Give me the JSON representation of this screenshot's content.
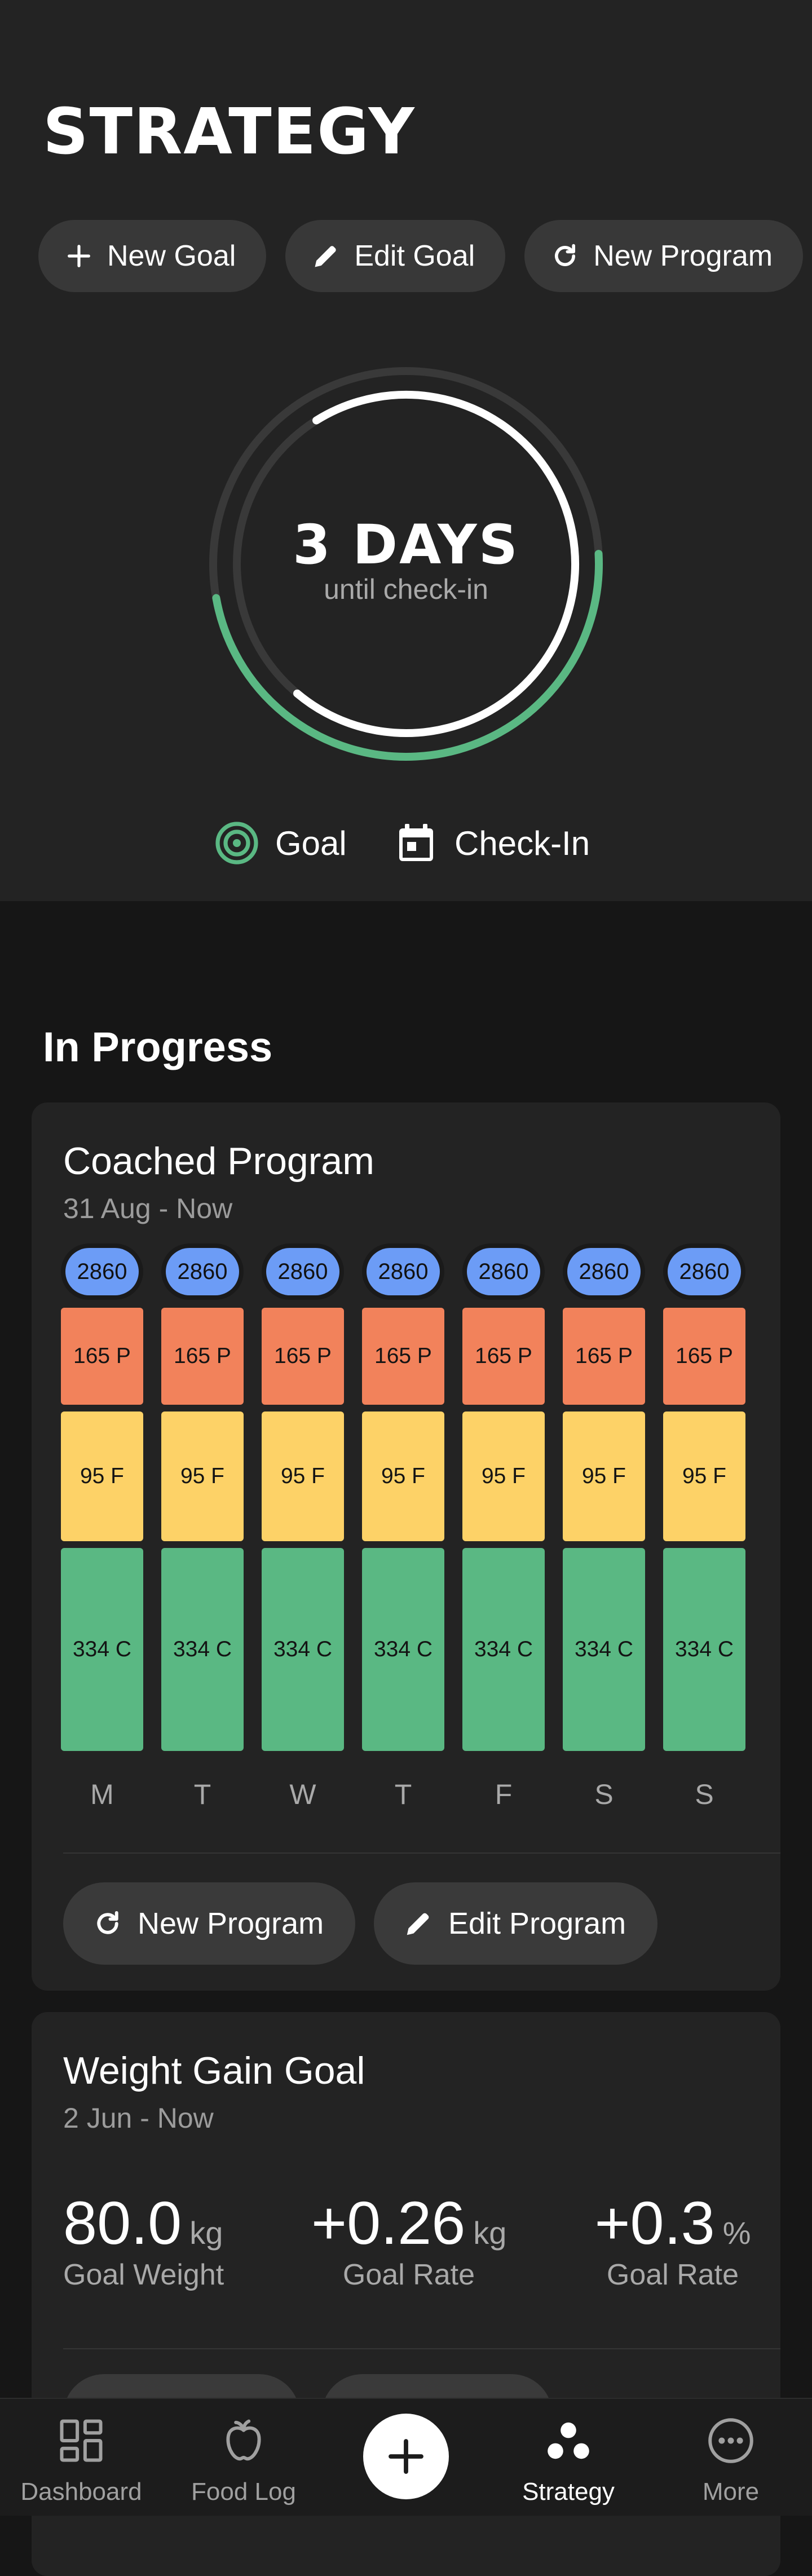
{
  "page": {
    "title": "STRATEGY"
  },
  "actions": {
    "new_goal": "New Goal",
    "edit_goal": "Edit Goal",
    "new_program": "New Program"
  },
  "checkin": {
    "value": "3 DAYS",
    "subtitle": "until check-in",
    "goal_progress": 0.48,
    "checkin_progress": 0.7,
    "legend_goal": "Goal",
    "legend_checkin": "Check-In",
    "colors": {
      "goal": "#5ab883",
      "checkin": "#ffffff",
      "track": "#393939"
    }
  },
  "in_progress": {
    "title": "In Progress",
    "program": {
      "title": "Coached Program",
      "date_range": "31 Aug - Now",
      "days": [
        {
          "letter": "M",
          "kcal": "2860",
          "protein": "165 P",
          "fat": "95 F",
          "carbs": "334 C"
        },
        {
          "letter": "T",
          "kcal": "2860",
          "protein": "165 P",
          "fat": "95 F",
          "carbs": "334 C"
        },
        {
          "letter": "W",
          "kcal": "2860",
          "protein": "165 P",
          "fat": "95 F",
          "carbs": "334 C"
        },
        {
          "letter": "T",
          "kcal": "2860",
          "protein": "165 P",
          "fat": "95 F",
          "carbs": "334 C"
        },
        {
          "letter": "F",
          "kcal": "2860",
          "protein": "165 P",
          "fat": "95 F",
          "carbs": "334 C"
        },
        {
          "letter": "S",
          "kcal": "2860",
          "protein": "165 P",
          "fat": "95 F",
          "carbs": "334 C"
        },
        {
          "letter": "S",
          "kcal": "2860",
          "protein": "165 P",
          "fat": "95 F",
          "carbs": "334 C"
        }
      ],
      "colors": {
        "kcal": "#6c9cf6",
        "protein": "#f2825b",
        "fat": "#fdd267",
        "carbs": "#5ab883"
      },
      "new_program": "New Program",
      "edit_program": "Edit Program"
    },
    "goal": {
      "title": "Weight Gain Goal",
      "date_range": "2 Jun - Now",
      "stats": [
        {
          "value": "80.0",
          "unit": "kg",
          "label": "Goal Weight"
        },
        {
          "value": "+0.26",
          "unit": "kg",
          "label": "Goal Rate"
        },
        {
          "value": "+0.3",
          "unit": "%",
          "label": "Goal Rate"
        }
      ]
    }
  },
  "nav": {
    "items": [
      {
        "label": "Dashboard",
        "icon": "dashboard-icon"
      },
      {
        "label": "Food Log",
        "icon": "apple-icon"
      },
      {
        "label": "",
        "icon": "plus-icon"
      },
      {
        "label": "Strategy",
        "icon": "strategy-icon",
        "active": true
      },
      {
        "label": "More",
        "icon": "more-icon"
      }
    ]
  }
}
